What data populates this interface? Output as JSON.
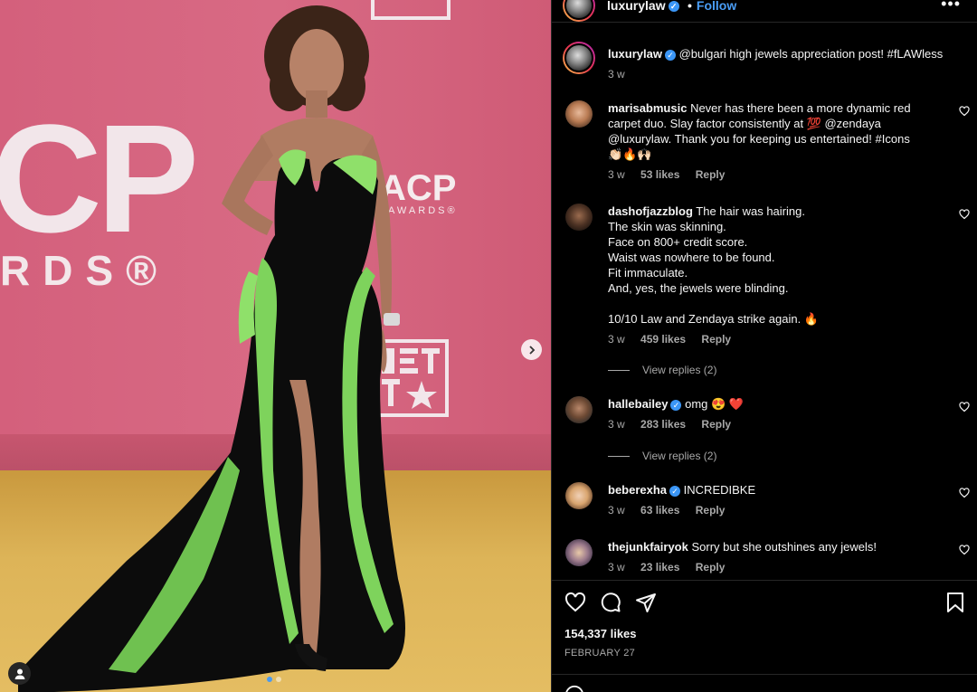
{
  "header": {
    "username": "luxurylaw",
    "separator": "•",
    "follow_label": "Follow",
    "more": "•••"
  },
  "caption": {
    "username": "luxurylaw",
    "text": "@bulgari high jewels appreciation post! #fLAWless",
    "time": "3 w"
  },
  "photo": {
    "backdrop_letters": "CP",
    "backdrop_sub": "RDS®",
    "logo_small": "ACP",
    "logo_small_sub": "G AWARDS®",
    "bet_text": "BE T"
  },
  "comments": [
    {
      "username": "marisabmusic",
      "text": "Never has there been a more dynamic red carpet duo. Slay factor consistently at 💯 @zendaya @luxurylaw. Thank you for keeping us entertained! #Icons 👏🏻🔥🙌🏻",
      "time": "3 w",
      "likes": "53 likes",
      "reply": "Reply",
      "verified": false
    },
    {
      "username": "dashofjazzblog",
      "lines": [
        "The hair was hairing.",
        "The skin was skinning.",
        "Face on 800+ credit score.",
        "Waist was nowhere to be found.",
        "Fit immaculate.",
        "And, yes, the jewels were blinding.",
        "",
        "10/10 Law and Zendaya strike again. 🔥"
      ],
      "time": "3 w",
      "likes": "459 likes",
      "reply": "Reply",
      "view_replies": "View replies (2)",
      "verified": false
    },
    {
      "username": "hallebailey",
      "text": "omg 😍 ❤️",
      "time": "3 w",
      "likes": "283 likes",
      "reply": "Reply",
      "view_replies": "View replies (2)",
      "verified": true
    },
    {
      "username": "beberexha",
      "text": "INCREDIBKE",
      "time": "3 w",
      "likes": "63 likes",
      "reply": "Reply",
      "verified": true
    },
    {
      "username": "thejunkfairyok",
      "text": "Sorry but she outshines any jewels!",
      "time": "3 w",
      "likes": "23 likes",
      "reply": "Reply",
      "verified": false
    }
  ],
  "stats": {
    "likes": "154,337 likes",
    "date": "FEBRUARY 27"
  },
  "icons": {
    "like": "heart-icon",
    "comment": "comment-icon",
    "share": "share-icon",
    "save": "bookmark-icon",
    "next": "chevron-right-icon",
    "tags": "user-tag-icon"
  },
  "colors": {
    "accent_blue": "#4a9df5",
    "verified_blue": "#3b96f6",
    "secondary_text": "#a8a8a8",
    "backdrop_pink": "#d4607c",
    "carpet_gold": "#ddb458",
    "dress_green": "#8fe06a"
  }
}
